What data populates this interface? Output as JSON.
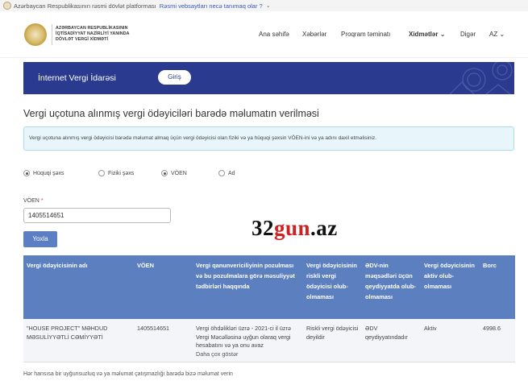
{
  "gov_bar": {
    "text": "Azərbaycan Respublikasının rəsmi dövlət platforması",
    "link": "Rəsmi vebsaytları necə tanımaq olar ?"
  },
  "header": {
    "logo_lines": [
      "AZƏRBAYCAN RESPUBLİKASININ",
      "İQTİSADİYYAT NAZİRLİYİ YANINDA",
      "DÖVLƏT VERGİ XİDMƏTİ"
    ],
    "nav": [
      "Ana səhifə",
      "Xəbərlər",
      "Proqram təminatı",
      "Xidmətlər",
      "Digər",
      "AZ"
    ]
  },
  "banner": {
    "title": "İnternet Vergi İdarəsi",
    "button": "Giriş"
  },
  "main": {
    "title": "Vergi uçotuna alınmış vergi ödəyiciləri barədə məlumatın verilməsi",
    "info": "Vergi uçotuna alınmış vergi ödəyicisi barədə məlumat almaq üçün vergi ödəyicisi olan fiziki və ya hüquqi şəxsin VÖEN-ini və ya adını daxil etməlisiniz.",
    "radios": [
      {
        "label": "Hüquqi şəxs",
        "checked": true
      },
      {
        "label": "Fiziki şəxs",
        "checked": false
      },
      {
        "label": "VÖEN",
        "checked": true
      },
      {
        "label": "Ad",
        "checked": false
      }
    ],
    "voen_label": "VÖEN",
    "required_mark": "*",
    "voen_value": "1405514651",
    "check_button": "Yoxla"
  },
  "watermark": {
    "part1": "32",
    "part2": "gun",
    "part3": ".az"
  },
  "table": {
    "headers": [
      "Vergi ödəyicisinin adı",
      "VÖEN",
      "Vergi qanunvericiliyinin pozulması və bu pozulmalara görə məsuliyyət tədbirləri haqqında",
      "Vergi ödəyicisinin riskli vergi ödəyicisi olub-olmaması",
      "ƏDV-nin məqsədləri üçün qeydiyyatda olub-olmaması",
      "Vergi ödəyicisinin aktiv olub-olmaması",
      "Borc"
    ],
    "row": {
      "name": "\"HOUSE PROJECT\" MƏHDUD MƏSULİYYƏTLİ CƏMİYYƏTİ",
      "voen": "1405514651",
      "violation": "Vergi öhdəlikləri üzrə - 2021-ci il üzrə Vergi Məcəlləsinə uyğun olaraq vergi hesabatını və ya onu avaz",
      "more": "Daha çox göstər",
      "risky": "Riskli vergi ödəyicisi deyildir",
      "vat": "ƏDV qeydiyyatındadır",
      "active": "Aktiv",
      "debt": "4998.6"
    }
  },
  "footer": {
    "note": "Hər hansısa bir uyğunsuzluq və ya məlumat çatışmazlığı barədə bizə məlumat verin"
  },
  "colors": {
    "banner_bg": "#2a3a8f",
    "table_header_bg": "#5b7fbf",
    "button_bg": "#5a7fc4",
    "info_bg": "#e8f6fb",
    "watermark_red": "#d21f1f"
  }
}
